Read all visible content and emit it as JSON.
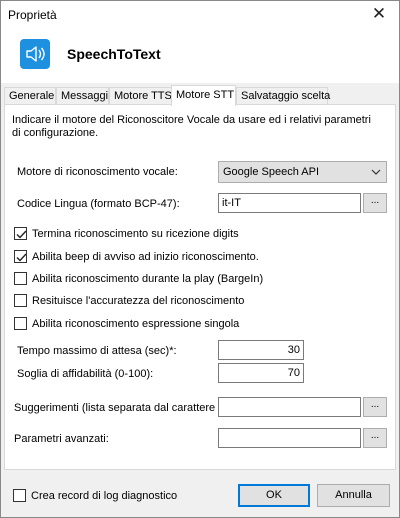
{
  "window": {
    "title": "Proprietà"
  },
  "header": {
    "app_name": "SpeechToText",
    "icon": "speaker-icon"
  },
  "tabs": [
    {
      "label": "Generale",
      "active": false
    },
    {
      "label": "Messaggi",
      "active": false
    },
    {
      "label": "Motore TTS",
      "active": false
    },
    {
      "label": "Motore STT",
      "active": true
    },
    {
      "label": "Salvataggio scelta",
      "active": false
    }
  ],
  "panel": {
    "description": "Indicare il motore del Riconoscitore Vocale da usare ed i relativi parametri di configurazione.",
    "engine": {
      "label": "Motore di riconoscimento vocale:",
      "value": "Google Speech API"
    },
    "language": {
      "label": "Codice Lingua (formato BCP-47):",
      "value": "it-IT",
      "browse": "..."
    },
    "checkboxes": [
      {
        "label": "Termina riconoscimento su ricezione digits",
        "checked": true
      },
      {
        "label": "Abilita beep di avviso ad inizio riconoscimento.",
        "checked": true
      },
      {
        "label": "Abilita riconoscimento durante la play (BargeIn)",
        "checked": false
      },
      {
        "label": "Resituisce l'accuratezza del riconoscimento",
        "checked": false
      },
      {
        "label": "Abilita riconoscimento espressione singola",
        "checked": false
      }
    ],
    "max_wait": {
      "label": "Tempo massimo di attesa (sec)*:",
      "value": "30"
    },
    "threshold": {
      "label": "Soglia di affidabilità (0-100):",
      "value": "70"
    },
    "suggestions": {
      "label": "Suggerimenti (lista separata dal carattere |):",
      "value": "",
      "browse": "..."
    },
    "advanced": {
      "label": "Parametri avanzati:",
      "value": "",
      "browse": "..."
    }
  },
  "footer": {
    "log_checkbox": {
      "label": "Crea record di log diagnostico",
      "checked": false
    },
    "ok_label": "OK",
    "cancel_label": "Annulla"
  }
}
